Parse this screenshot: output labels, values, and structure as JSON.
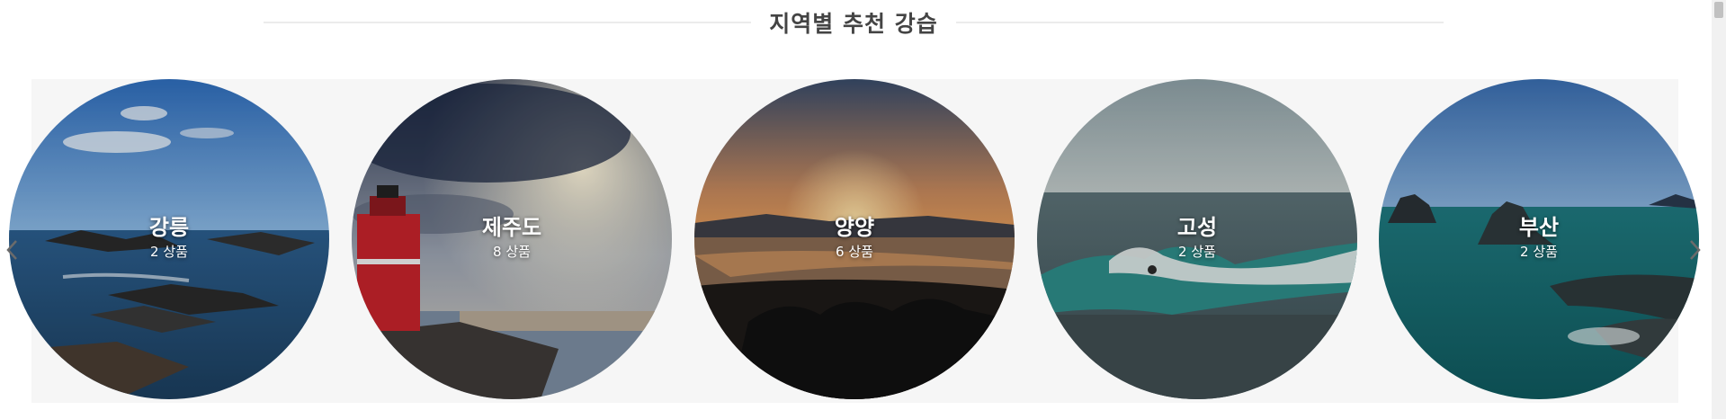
{
  "section": {
    "title": "지역별 추천 강습"
  },
  "regions": [
    {
      "name": "강릉",
      "count": "2 상품"
    },
    {
      "name": "제주도",
      "count": "8 상품"
    },
    {
      "name": "양양",
      "count": "6 상품"
    },
    {
      "name": "고성",
      "count": "2 상품"
    },
    {
      "name": "부산",
      "count": "2 상품"
    }
  ],
  "carousel": {
    "prev_icon": "chevron-left-icon",
    "next_icon": "chevron-right-icon"
  },
  "colors": {
    "title": "#444444",
    "rule": "#ececec",
    "label": "#ffffff"
  }
}
